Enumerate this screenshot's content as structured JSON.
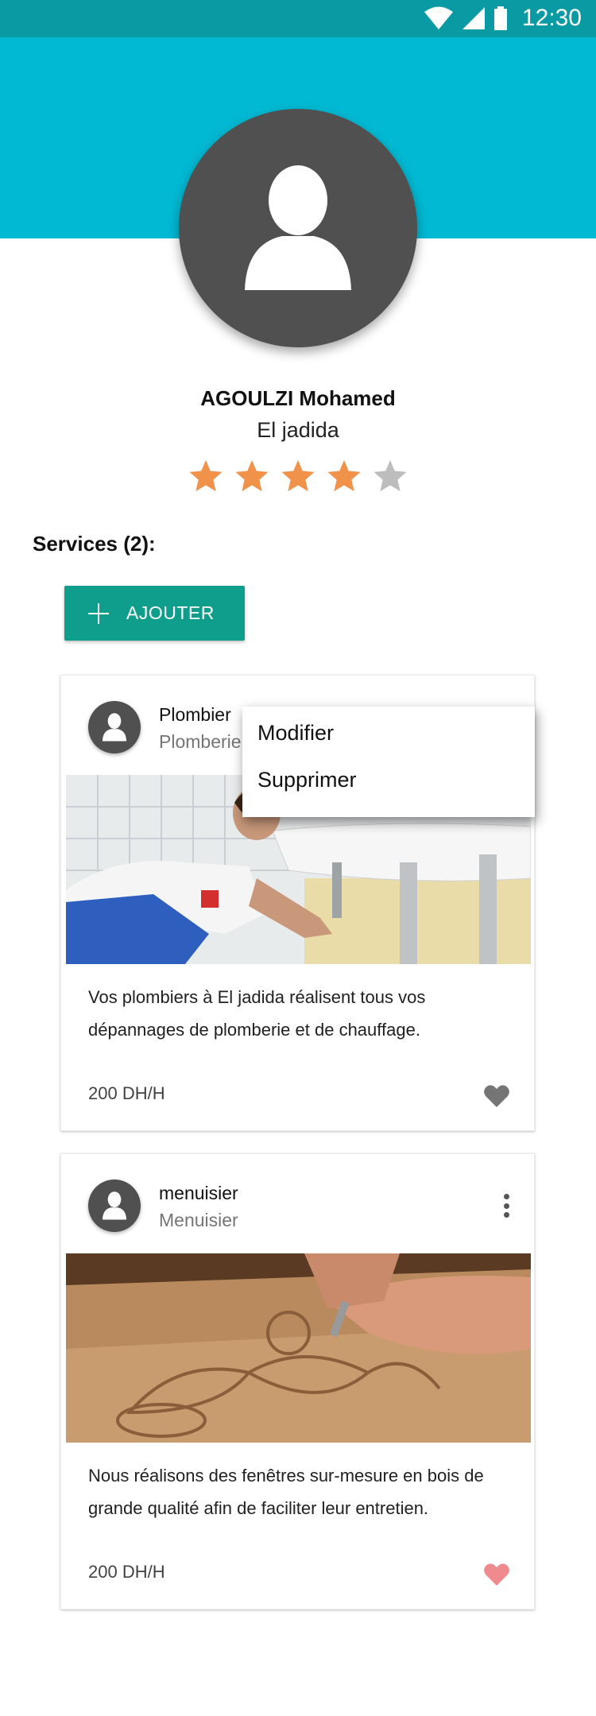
{
  "status_bar": {
    "time": "12:30"
  },
  "profile": {
    "name": "AGOULZI Mohamed",
    "city": "El jadida",
    "rating": 4,
    "max_rating": 5
  },
  "services": {
    "title": "Services (2):",
    "add_label": "AJOUTER",
    "items": [
      {
        "title": "Plombier",
        "category": "Plomberie",
        "description": "Vos plombiers à El jadida réalisent tous vos dépannages de plomberie et de chauffage.",
        "price": "200 DH/H",
        "liked": false
      },
      {
        "title": "menuisier",
        "category": "Menuisier",
        "description": "Nous réalisons des fenêtres sur-mesure en bois de grande qualité afin de faciliter leur entretien.",
        "price": "200 DH/H",
        "liked": true
      }
    ]
  },
  "context_menu": {
    "edit_label": "Modifier",
    "delete_label": "Supprimer"
  },
  "colors": {
    "status_bar": "#0a9aa3",
    "header": "#01b9d3",
    "accent_button": "#0f9d8c",
    "star_active": "#f0924a",
    "star_inactive": "#bdbdbd",
    "heart_inactive": "#757575",
    "heart_active": "#ef8a8f",
    "avatar": "#505050"
  }
}
